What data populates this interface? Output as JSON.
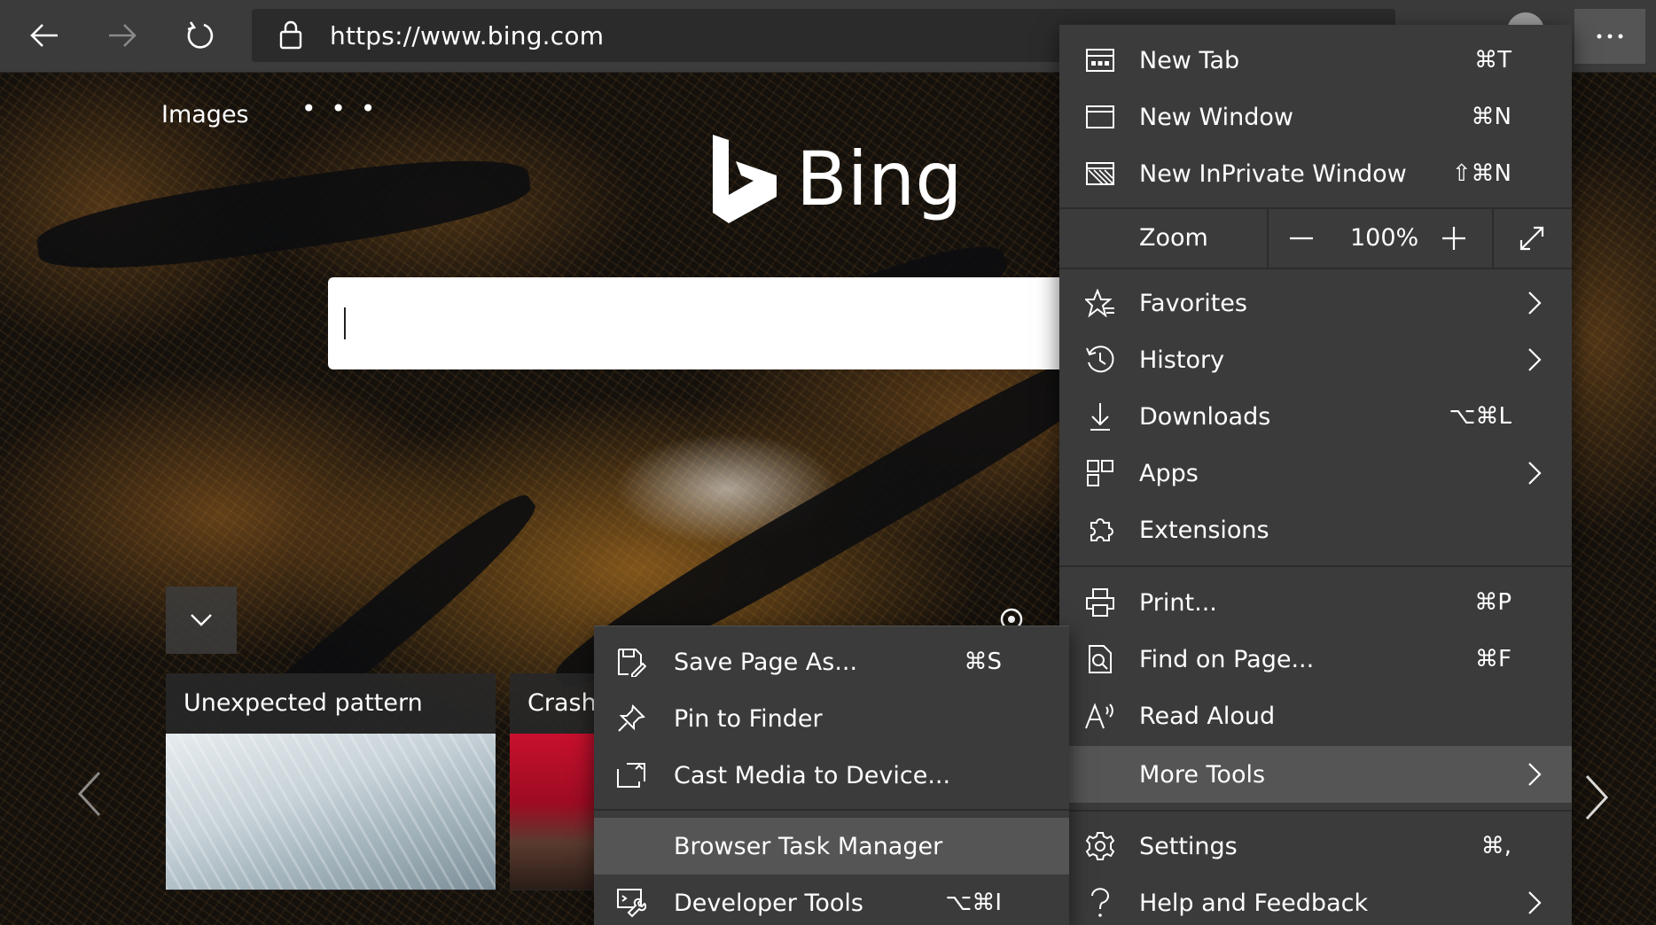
{
  "toolbar": {
    "url": "https://www.bing.com",
    "back_icon": "back-arrow-icon",
    "forward_icon": "forward-arrow-icon",
    "refresh_icon": "refresh-icon",
    "lock_icon": "lock-icon",
    "more_icon": "ellipsis-icon"
  },
  "page": {
    "nav_images": "Images",
    "nav_more": "• • •",
    "logo_text": "Bing",
    "cards": [
      {
        "title": "Unexpected pattern"
      },
      {
        "title": "Crash"
      }
    ]
  },
  "menu": {
    "items": [
      {
        "label": "New Tab",
        "shortcut": "⌘T",
        "icon": "new-tab-icon"
      },
      {
        "label": "New Window",
        "shortcut": "⌘N",
        "icon": "new-window-icon"
      },
      {
        "label": "New InPrivate Window",
        "shortcut": "⇧⌘N",
        "icon": "inprivate-icon"
      }
    ],
    "zoom": {
      "label": "Zoom",
      "value": "100%",
      "minus": "−",
      "plus": "+"
    },
    "items2": [
      {
        "label": "Favorites",
        "icon": "favorites-icon",
        "submenu": true
      },
      {
        "label": "History",
        "icon": "history-icon",
        "submenu": true
      },
      {
        "label": "Downloads",
        "shortcut": "⌥⌘L",
        "icon": "download-icon"
      },
      {
        "label": "Apps",
        "icon": "apps-icon",
        "submenu": true
      },
      {
        "label": "Extensions",
        "icon": "extensions-icon"
      }
    ],
    "items3": [
      {
        "label": "Print...",
        "shortcut": "⌘P",
        "icon": "print-icon"
      },
      {
        "label": "Find on Page...",
        "shortcut": "⌘F",
        "icon": "find-icon"
      },
      {
        "label": "Read Aloud",
        "icon": "read-aloud-icon"
      },
      {
        "label": "More Tools",
        "icon": "",
        "submenu": true,
        "highlighted": true
      }
    ],
    "items4": [
      {
        "label": "Settings",
        "shortcut": "⌘,",
        "icon": "settings-icon"
      },
      {
        "label": "Help and Feedback",
        "icon": "help-icon",
        "submenu": true
      }
    ]
  },
  "submenu": {
    "items": [
      {
        "label": "Save Page As...",
        "shortcut": "⌘S",
        "icon": "save-icon"
      },
      {
        "label": "Pin to Finder",
        "icon": "pin-icon"
      },
      {
        "label": "Cast Media to Device...",
        "icon": "cast-icon"
      },
      {
        "label": "Browser Task Manager",
        "highlighted": true
      },
      {
        "label": "Developer Tools",
        "shortcut": "⌥⌘I",
        "icon": "devtools-icon"
      }
    ]
  }
}
